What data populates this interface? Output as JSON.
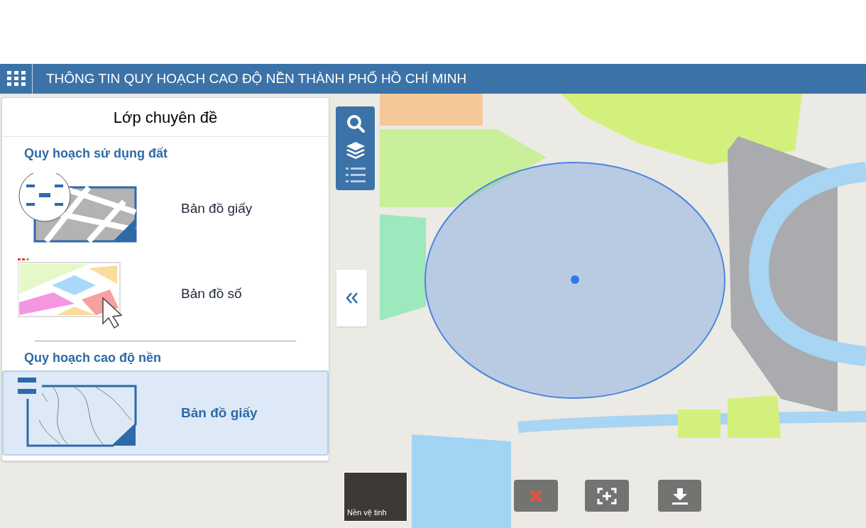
{
  "header": {
    "title": "THÔNG TIN QUY HOẠCH CAO ĐỘ NỀN THÀNH PHỐ HỒ CHÍ MINH"
  },
  "panel": {
    "title": "Lớp chuyên đề",
    "groups": [
      {
        "title": "Quy hoạch sử dụng đất",
        "items": [
          {
            "kind": "paper",
            "label": "Bản đồ giấy",
            "selected": false
          },
          {
            "kind": "digital",
            "label": "Bản đồ số",
            "selected": false
          }
        ]
      },
      {
        "title": "Quy hoạch cao độ nền",
        "items": [
          {
            "kind": "contour",
            "label": "Bản đồ giấy",
            "selected": true
          }
        ]
      }
    ]
  },
  "basemap": {
    "label": "Nền vệ tinh"
  }
}
